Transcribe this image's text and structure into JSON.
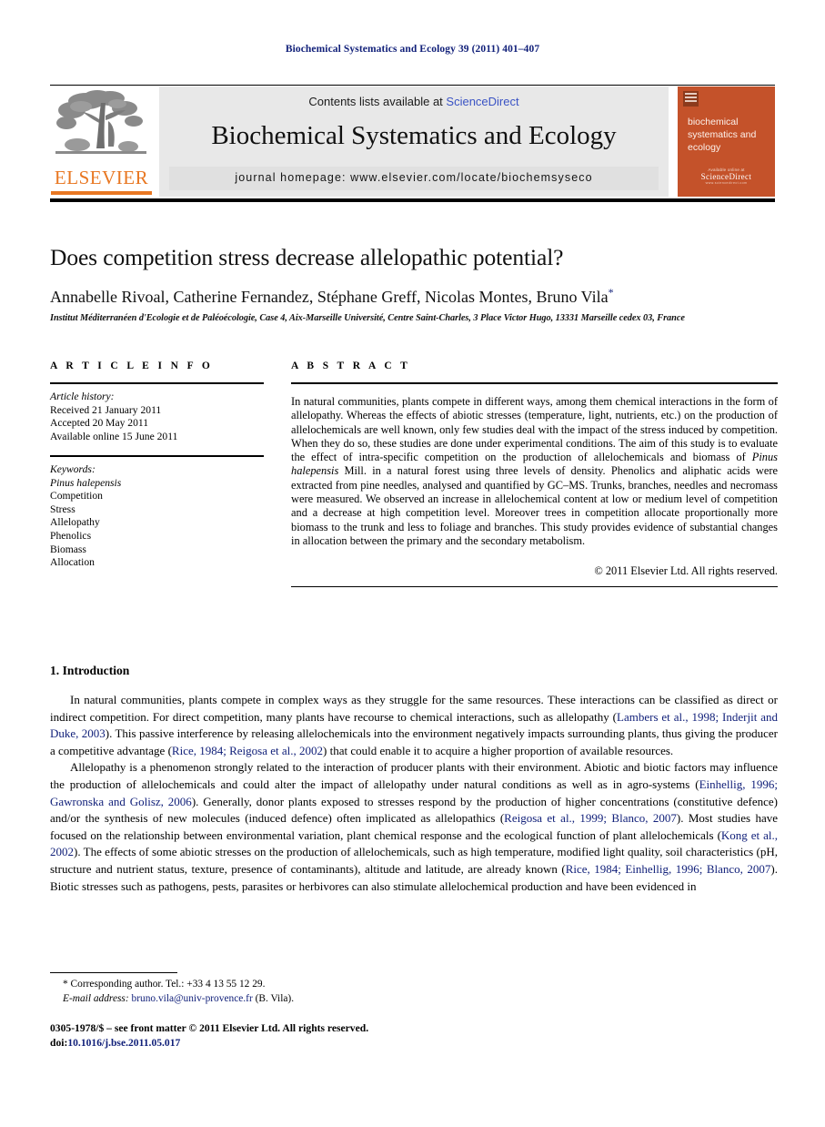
{
  "running_head": "Biochemical Systematics and Ecology 39 (2011) 401–407",
  "masthead": {
    "contents_prefix": "Contents lists available at ",
    "sciencedirect": "ScienceDirect",
    "journal_title": "Biochemical Systematics and Ecology",
    "homepage": "journal homepage: www.elsevier.com/locate/biochemsyseco",
    "publisher_name": "ELSEVIER",
    "cover_title": "biochemical systematics and ecology",
    "cover_footer_top": "Available online at",
    "cover_footer_mid": "ScienceDirect",
    "cover_footer_bottom": "www.sciencedirect.com",
    "accent_orange": "#e87722",
    "cover_color": "#c4522a",
    "band_gray": "#e8e8e8",
    "link_blue": "#12217a"
  },
  "article": {
    "title": "Does competition stress decrease allelopathic potential?",
    "authors": "Annabelle Rivoal, Catherine Fernandez, Stéphane Greff, Nicolas Montes, Bruno Vila",
    "corresponding_marker": "*",
    "affiliation": "Institut Méditerranéen d'Ecologie et de Paléoécologie, Case 4, Aix-Marseille Université, Centre Saint-Charles, 3 Place Victor Hugo, 13331 Marseille cedex 03, France"
  },
  "article_info": {
    "heading": "A R T I C L E  I N F O",
    "history_label": "Article history:",
    "history": [
      "Received 21 January 2011",
      "Accepted 20 May 2011",
      "Available online 15 June 2011"
    ],
    "keywords_label": "Keywords:",
    "keywords": [
      "Pinus halepensis",
      "Competition",
      "Stress",
      "Allelopathy",
      "Phenolics",
      "Biomass",
      "Allocation"
    ],
    "keyword_italic_index": 0
  },
  "abstract": {
    "heading": "A B S T R A C T",
    "body_part1": "In natural communities, plants compete in different ways, among them chemical interactions in the form of allelopathy. Whereas the effects of abiotic stresses (temperature, light, nutrients, etc.) on the production of allelochemicals are well known, only few studies deal with the impact of the stress induced by competition. When they do so, these studies are done under experimental conditions. The aim of this study is to evaluate the effect of intra-specific competition on the production of allelochemicals and biomass of ",
    "species_1": "Pinus halepensis",
    "body_part2": " Mill. in a natural forest using three levels of density. Phenolics and aliphatic acids were extracted from pine needles, analysed and quantified by GC–MS. Trunks, branches, needles and necromass were measured. We observed an increase in allelochemical content at low or medium level of competition and a decrease at high competition level. Moreover trees in competition allocate proportionally more biomass to the trunk and less to foliage and branches. This study provides evidence of substantial changes in allocation between the primary and the secondary metabolism.",
    "copyright": "© 2011 Elsevier Ltd. All rights reserved."
  },
  "introduction": {
    "heading": "1. Introduction",
    "p1_a": "In natural communities, plants compete in complex ways as they struggle for the same resources. These interactions can be classified as direct or indirect competition. For direct competition, many plants have recourse to chemical interactions, such as allelopathy (",
    "p1_ref1": "Lambers et al., 1998; Inderjit and Duke, 2003",
    "p1_b": "). This passive interference by releasing allelochemicals into the environment negatively impacts surrounding plants, thus giving the producer a competitive advantage (",
    "p1_ref2": "Rice, 1984; Reigosa et al., 2002",
    "p1_c": ") that could enable it to acquire a higher proportion of available resources.",
    "p2_a": "Allelopathy is a phenomenon strongly related to the interaction of producer plants with their environment. Abiotic and biotic factors may influence the production of allelochemicals and could alter the impact of allelopathy under natural conditions as well as in agro-systems (",
    "p2_ref1": "Einhellig, 1996; Gawronska and Golisz, 2006",
    "p2_b": "). Generally, donor plants exposed to stresses respond by the production of higher concentrations (constitutive defence) and/or the synthesis of new molecules (induced defence) often implicated as allelopathics (",
    "p2_ref2": "Reigosa et al., 1999; Blanco, 2007",
    "p2_c": "). Most studies have focused on the relationship between environmental variation, plant chemical response and the ecological function of plant allelochemicals (",
    "p2_ref3": "Kong et al., 2002",
    "p2_d": "). The effects of some abiotic stresses on the production of allelochemicals, such as high temperature, modified light quality, soil characteristics (pH, structure and nutrient status, texture, presence of contaminants), altitude and latitude, are already known (",
    "p2_ref4": "Rice, 1984; Einhellig, 1996; Blanco, 2007",
    "p2_e": "). Biotic stresses such as pathogens, pests, parasites or herbivores can also stimulate allelochemical production and have been evidenced in"
  },
  "footer": {
    "corresponding": "* Corresponding author. Tel.: +33 4 13 55 12 29.",
    "email_label": "E-mail address:",
    "email": "bruno.vila@univ-provence.fr",
    "email_owner": "(B. Vila).",
    "issn_line": "0305-1978/$ – see front matter © 2011 Elsevier Ltd. All rights reserved.",
    "doi_label": "doi:",
    "doi": "10.1016/j.bse.2011.05.017"
  }
}
